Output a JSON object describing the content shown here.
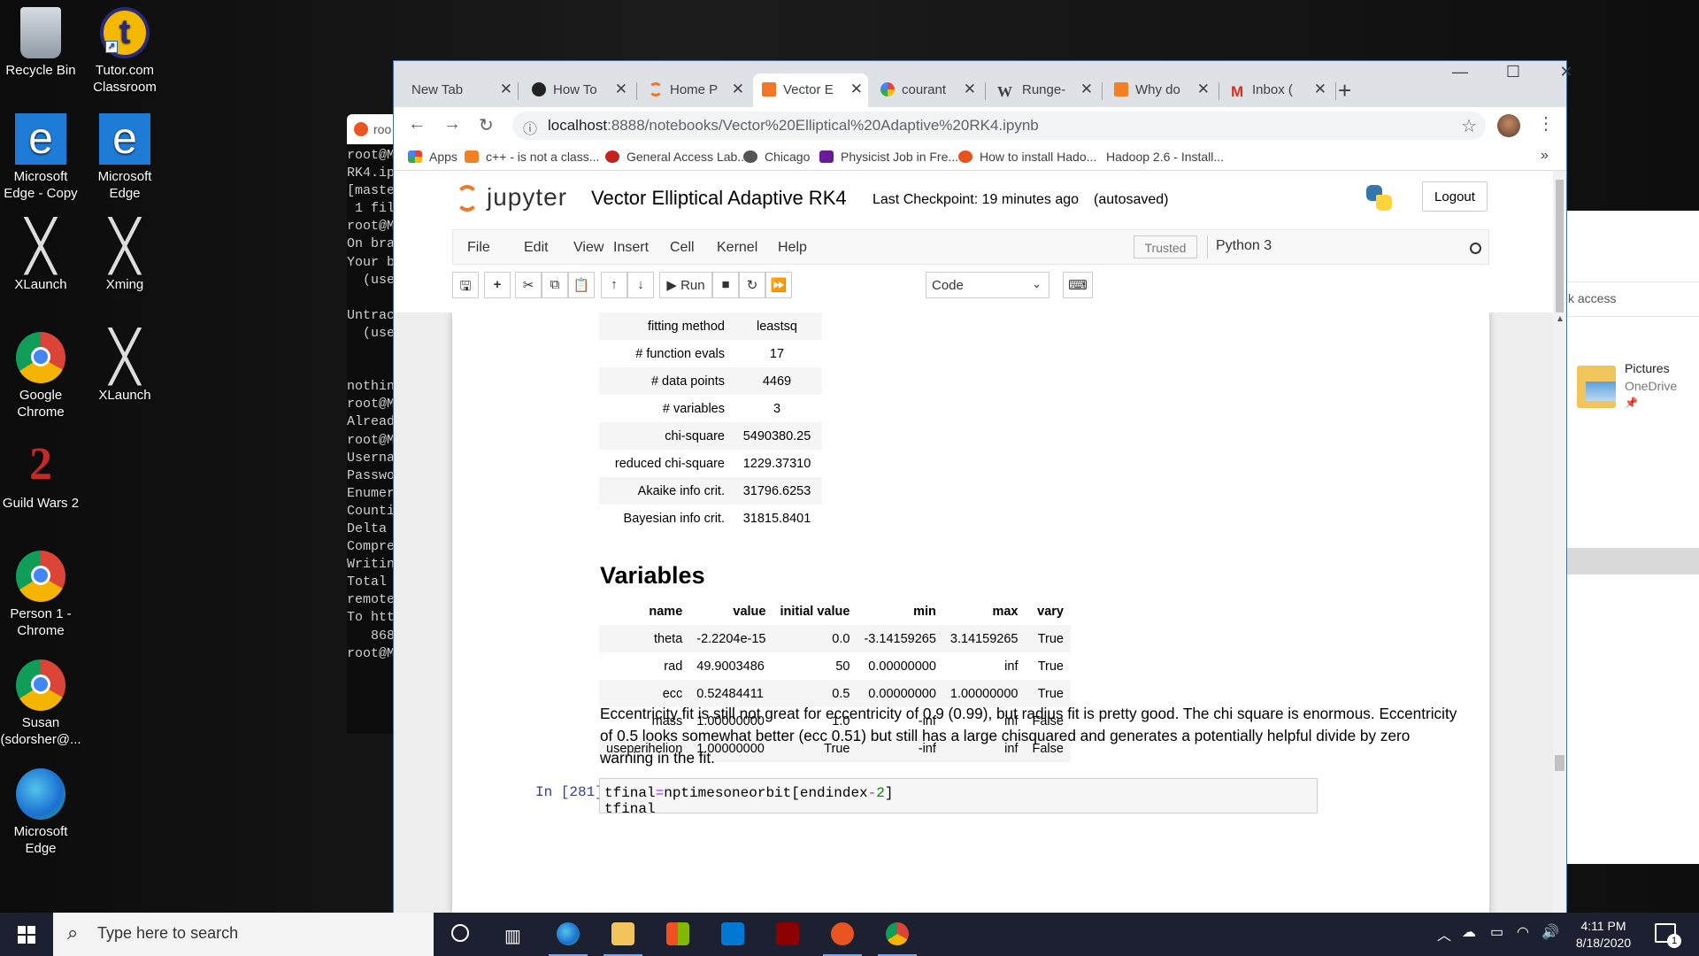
{
  "desktop": {
    "icons": [
      {
        "label": "Recycle Bin"
      },
      {
        "label": "Tutor.com Classroom"
      },
      {
        "label": "Microsoft Edge - Copy"
      },
      {
        "label": "Microsoft Edge"
      },
      {
        "label": "XLaunch"
      },
      {
        "label": "Xming"
      },
      {
        "label": "Google Chrome"
      },
      {
        "label": "XLaunch"
      },
      {
        "label": "Guild Wars 2"
      },
      {
        "label": "Person 1 - Chrome"
      },
      {
        "label": "Susan (sdorsher@..."
      },
      {
        "label": "Microsoft Edge"
      }
    ],
    "terminal": {
      "tab_label": "roo",
      "lines": [
        "root@M",
        "RK4.ip",
        "[maste",
        " 1 fil",
        "root@M",
        "On bra",
        "Your b",
        "  (use",
        "",
        "Untrac",
        "  (use",
        "",
        "",
        "nothin",
        "root@M",
        "Alread",
        "root@M",
        "Userna",
        "Passwo",
        "Enumer",
        "Counti",
        "Delta ",
        "Compre",
        "Writin",
        "Total ",
        "remote",
        "To htt",
        "   868",
        "root@M"
      ]
    },
    "explorer": {
      "access_label": "k access",
      "folder_name": "Pictures",
      "folder_location": "OneDrive"
    }
  },
  "browser": {
    "tabs": [
      {
        "title": "New Tab",
        "color": "#ffffff"
      },
      {
        "title": "How To",
        "color": "#222222"
      },
      {
        "title": "Home P",
        "color": "#f37626"
      },
      {
        "title": "Vector E",
        "color": "#f37626",
        "active": true
      },
      {
        "title": "courant",
        "color": "#4285f4"
      },
      {
        "title": "Runge-",
        "color": "#000000"
      },
      {
        "title": "Why do",
        "color": "#f48024"
      },
      {
        "title": "Inbox (",
        "color": "#d93025"
      }
    ],
    "new_tab_symbol": "+",
    "window_controls": {
      "minimize": "—",
      "maximize": "☐",
      "close": "✕"
    },
    "url": {
      "host": "localhost",
      "path": ":8888/notebooks/Vector%20Elliptical%20Adaptive%20RK4.ipynb"
    },
    "bookmarks": [
      {
        "label": "Apps",
        "color": "#ea4335"
      },
      {
        "label": "c++ - is not a class...",
        "color": "#f48024"
      },
      {
        "label": "General Access Lab...",
        "color": "#c5221f"
      },
      {
        "label": "Chicago",
        "color": "#555555"
      },
      {
        "label": "Physicist Job in Fre...",
        "color": "#6a1b9a"
      },
      {
        "label": "How to install Hado...",
        "color": "#e8531d"
      },
      {
        "label": "Hadoop 2.6 - Install...",
        "color": "#ffffff"
      }
    ],
    "bookmarks_more": "»"
  },
  "jupyter": {
    "logo_text": "jupyter",
    "notebook_title": "Vector Elliptical Adaptive RK4",
    "checkpoint": "Last Checkpoint: 19 minutes ago",
    "autosave": "(autosaved)",
    "logout_label": "Logout",
    "menus": [
      "File",
      "Edit",
      "View",
      "Insert",
      "Cell",
      "Kernel",
      "Help"
    ],
    "trusted_label": "Trusted",
    "kernel_label": "Python 3",
    "toolbar": {
      "run_label": "Run",
      "cell_type": "Code"
    },
    "stats": [
      {
        "label": "fitting method",
        "value": "leastsq"
      },
      {
        "label": "# function evals",
        "value": "17"
      },
      {
        "label": "# data points",
        "value": "4469"
      },
      {
        "label": "# variables",
        "value": "3"
      },
      {
        "label": "chi-square",
        "value": "5490380.25"
      },
      {
        "label": "reduced chi-square",
        "value": "1229.37310"
      },
      {
        "label": "Akaike info crit.",
        "value": "31796.6253"
      },
      {
        "label": "Bayesian info crit.",
        "value": "31815.8401"
      }
    ],
    "variables_heading": "Variables",
    "var_columns": [
      "name",
      "value",
      "initial value",
      "min",
      "max",
      "vary"
    ],
    "variables": [
      [
        "theta",
        "-2.2204e-15",
        "0.0",
        "-3.14159265",
        "3.14159265",
        "True"
      ],
      [
        "rad",
        "49.9003486",
        "50",
        "0.00000000",
        "inf",
        "True"
      ],
      [
        "ecc",
        "0.52484411",
        "0.5",
        "0.00000000",
        "1.00000000",
        "True"
      ],
      [
        "mass",
        "1.00000000",
        "1.0",
        "-inf",
        "inf",
        "False"
      ],
      [
        "useperihelion",
        "1.00000000",
        "True",
        "-inf",
        "inf",
        "False"
      ]
    ],
    "markdown_text": "Eccentricity fit is still not great for eccentricity of 0.9 (0.99), but radius fit is pretty good. The chi square is enormous. Eccentricity of 0.5 looks somewhat better (ecc 0.51) but still has a large chisquared and generates a potentially helpful divide by zero warning in the fit.",
    "code_prompt": "In [281]:",
    "code_line": {
      "a": "tfinal",
      "eq": "=",
      "b": "nptimesoneorbit[endindex",
      "minus": "-",
      "num": "2",
      "close": "]"
    },
    "code_line2": "tfinal"
  },
  "taskbar": {
    "search_placeholder": "Type here to search",
    "time": "4:11 PM",
    "date": "8/18/2020",
    "notification_count": "1"
  }
}
